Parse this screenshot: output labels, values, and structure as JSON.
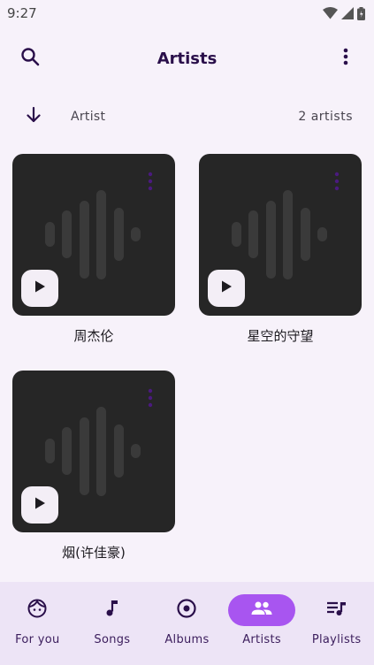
{
  "status_bar": {
    "time": "9:27"
  },
  "app_bar": {
    "title": "Artists"
  },
  "sort": {
    "label": "Artist",
    "count": "2 artists"
  },
  "artists": [
    {
      "name": "周杰伦"
    },
    {
      "name": "星空的守望"
    },
    {
      "name": "烟(许佳豪)"
    }
  ],
  "bottom_nav": {
    "items": [
      {
        "label": "For you",
        "icon": "face-icon"
      },
      {
        "label": "Songs",
        "icon": "music-note-icon"
      },
      {
        "label": "Albums",
        "icon": "album-icon"
      },
      {
        "label": "Artists",
        "icon": "people-icon",
        "active": true
      },
      {
        "label": "Playlists",
        "icon": "playlist-icon"
      }
    ]
  },
  "colors": {
    "background": "#f7f2fa",
    "accent": "#a855f0",
    "title": "#2a0f4a",
    "cover": "#262626",
    "nav_background": "#ede4f6"
  }
}
